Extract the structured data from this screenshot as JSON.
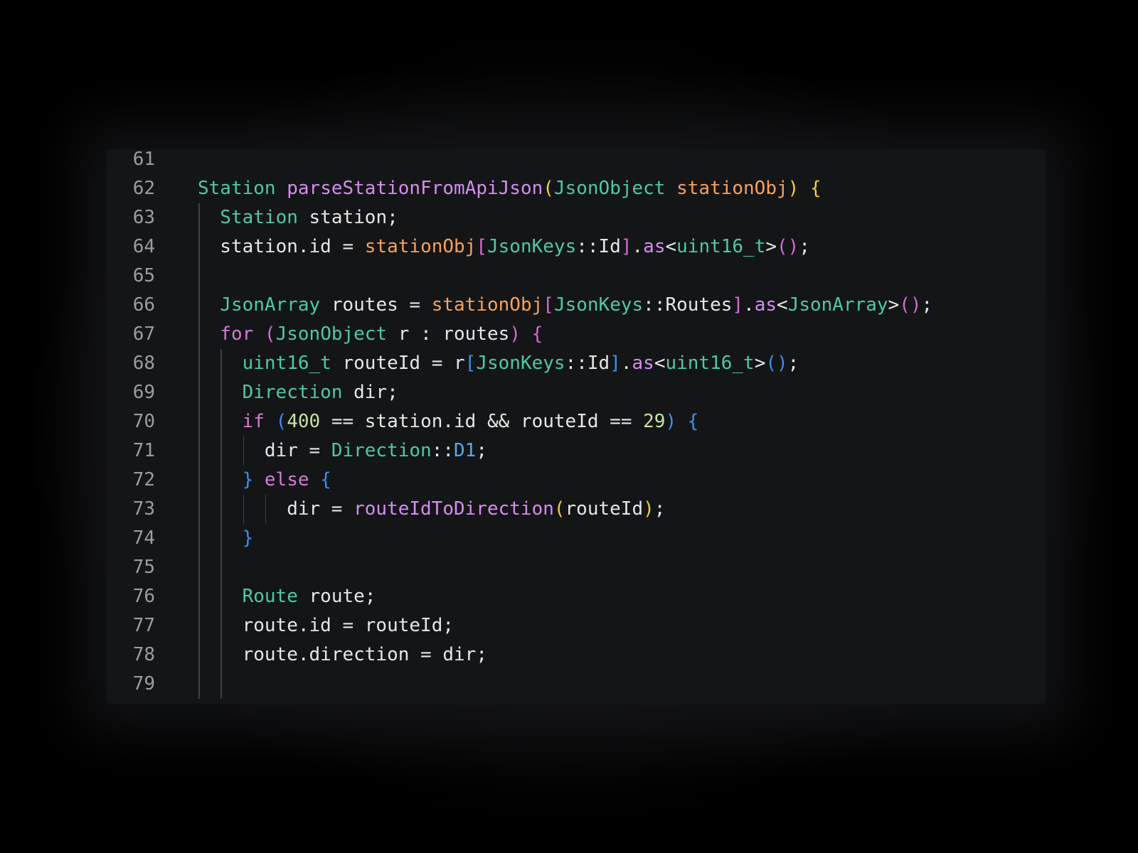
{
  "editor": {
    "lines": [
      {
        "number": "61",
        "indent": 0,
        "tokens": []
      },
      {
        "number": "62",
        "indent": 0,
        "tokens": [
          {
            "text": "Station ",
            "kind": "type"
          },
          {
            "text": "parseStationFromApiJson",
            "kind": "fn"
          },
          {
            "text": "(",
            "kind": "b-yellow"
          },
          {
            "text": "JsonObject ",
            "kind": "type"
          },
          {
            "text": "stationObj",
            "kind": "param"
          },
          {
            "text": ") {",
            "kind": "b-yellow"
          }
        ]
      },
      {
        "number": "63",
        "indent": 1,
        "tokens": [
          {
            "text": "Station ",
            "kind": "type"
          },
          {
            "text": "station;",
            "kind": "pl"
          }
        ]
      },
      {
        "number": "64",
        "indent": 1,
        "tokens": [
          {
            "text": "station.id = ",
            "kind": "pl"
          },
          {
            "text": "stationObj",
            "kind": "param"
          },
          {
            "text": "[",
            "kind": "b-pink"
          },
          {
            "text": "JsonKeys",
            "kind": "type"
          },
          {
            "text": "::Id",
            "kind": "pl"
          },
          {
            "text": "]",
            "kind": "b-pink"
          },
          {
            "text": ".",
            "kind": "pl"
          },
          {
            "text": "as",
            "kind": "fn"
          },
          {
            "text": "<",
            "kind": "pl"
          },
          {
            "text": "uint16_t",
            "kind": "type"
          },
          {
            "text": ">",
            "kind": "pl"
          },
          {
            "text": "()",
            "kind": "b-pink"
          },
          {
            "text": ";",
            "kind": "pl"
          }
        ]
      },
      {
        "number": "65",
        "indent": 1,
        "tokens": []
      },
      {
        "number": "66",
        "indent": 1,
        "tokens": [
          {
            "text": "JsonArray ",
            "kind": "type"
          },
          {
            "text": "routes = ",
            "kind": "pl"
          },
          {
            "text": "stationObj",
            "kind": "param"
          },
          {
            "text": "[",
            "kind": "b-pink"
          },
          {
            "text": "JsonKeys",
            "kind": "type"
          },
          {
            "text": "::Routes",
            "kind": "pl"
          },
          {
            "text": "]",
            "kind": "b-pink"
          },
          {
            "text": ".",
            "kind": "pl"
          },
          {
            "text": "as",
            "kind": "fn"
          },
          {
            "text": "<",
            "kind": "pl"
          },
          {
            "text": "JsonArray",
            "kind": "type"
          },
          {
            "text": ">",
            "kind": "pl"
          },
          {
            "text": "()",
            "kind": "b-pink"
          },
          {
            "text": ";",
            "kind": "pl"
          }
        ]
      },
      {
        "number": "67",
        "indent": 1,
        "tokens": [
          {
            "text": "for ",
            "kind": "kw"
          },
          {
            "text": "(",
            "kind": "b-pink"
          },
          {
            "text": "JsonObject ",
            "kind": "type"
          },
          {
            "text": "r : routes",
            "kind": "pl"
          },
          {
            "text": ") {",
            "kind": "b-pink"
          }
        ]
      },
      {
        "number": "68",
        "indent": 2,
        "tokens": [
          {
            "text": "uint16_t ",
            "kind": "type"
          },
          {
            "text": "routeId = r",
            "kind": "pl"
          },
          {
            "text": "[",
            "kind": "b-blue"
          },
          {
            "text": "JsonKeys",
            "kind": "type"
          },
          {
            "text": "::Id",
            "kind": "pl"
          },
          {
            "text": "]",
            "kind": "b-blue"
          },
          {
            "text": ".",
            "kind": "pl"
          },
          {
            "text": "as",
            "kind": "fn"
          },
          {
            "text": "<",
            "kind": "pl"
          },
          {
            "text": "uint16_t",
            "kind": "type"
          },
          {
            "text": ">",
            "kind": "pl"
          },
          {
            "text": "()",
            "kind": "b-blue"
          },
          {
            "text": ";",
            "kind": "pl"
          }
        ]
      },
      {
        "number": "69",
        "indent": 2,
        "tokens": [
          {
            "text": "Direction ",
            "kind": "type"
          },
          {
            "text": "dir;",
            "kind": "pl"
          }
        ]
      },
      {
        "number": "70",
        "indent": 2,
        "tokens": [
          {
            "text": "if ",
            "kind": "kw"
          },
          {
            "text": "(",
            "kind": "b-blue"
          },
          {
            "text": "400",
            "kind": "num"
          },
          {
            "text": " == station.id && routeId == ",
            "kind": "pl"
          },
          {
            "text": "29",
            "kind": "num"
          },
          {
            "text": ") {",
            "kind": "b-blue"
          }
        ]
      },
      {
        "number": "71",
        "indent": 3,
        "tokens": [
          {
            "text": "dir = ",
            "kind": "pl"
          },
          {
            "text": "Direction",
            "kind": "type"
          },
          {
            "text": "::",
            "kind": "pl"
          },
          {
            "text": "D1",
            "kind": "enum"
          },
          {
            "text": ";",
            "kind": "pl"
          }
        ]
      },
      {
        "number": "72",
        "indent": 2,
        "tokens": [
          {
            "text": "} ",
            "kind": "b-blue"
          },
          {
            "text": "else ",
            "kind": "kw"
          },
          {
            "text": "{",
            "kind": "b-blue"
          }
        ]
      },
      {
        "number": "73",
        "indent": 4,
        "tokens": [
          {
            "text": "dir = ",
            "kind": "pl"
          },
          {
            "text": "routeIdToDirection",
            "kind": "fn"
          },
          {
            "text": "(",
            "kind": "b-yellow"
          },
          {
            "text": "routeId",
            "kind": "pl"
          },
          {
            "text": ")",
            "kind": "b-yellow"
          },
          {
            "text": ";",
            "kind": "pl"
          }
        ]
      },
      {
        "number": "74",
        "indent": 2,
        "tokens": [
          {
            "text": "}",
            "kind": "b-blue"
          }
        ]
      },
      {
        "number": "75",
        "indent": 2,
        "tokens": []
      },
      {
        "number": "76",
        "indent": 2,
        "tokens": [
          {
            "text": "Route ",
            "kind": "type"
          },
          {
            "text": "route;",
            "kind": "pl"
          }
        ]
      },
      {
        "number": "77",
        "indent": 2,
        "tokens": [
          {
            "text": "route.id = routeId;",
            "kind": "pl"
          }
        ]
      },
      {
        "number": "78",
        "indent": 2,
        "tokens": [
          {
            "text": "route.direction = dir;",
            "kind": "pl"
          }
        ]
      },
      {
        "number": "79",
        "indent": 2,
        "tokens": []
      }
    ]
  }
}
